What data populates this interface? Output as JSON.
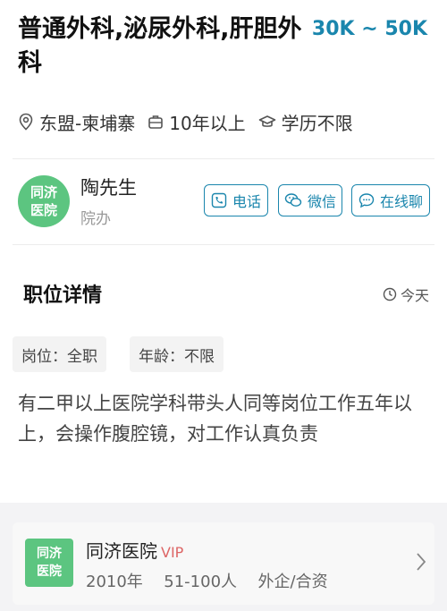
{
  "job": {
    "title": "普通外科,泌尿外科,肝胆外科",
    "salary": "30K ~ 50K",
    "location": "东盟-柬埔寨",
    "experience": "10年以上",
    "education": "学历不限"
  },
  "recruiter": {
    "avatar_text": "同济\n医院",
    "name": "陶先生",
    "department": "院办",
    "buttons": {
      "phone": "电话",
      "wechat": "微信",
      "chat": "在线聊"
    }
  },
  "details": {
    "section_title": "职位详情",
    "posted": "今天",
    "tags": [
      "岗位：全职",
      "年龄：不限"
    ],
    "description": "有二甲以上医院学科带头人同等岗位工作五年以上，会操作腹腔镜，对工作认真负责"
  },
  "company": {
    "logo_text": "同济\n医院",
    "name": "同济医院",
    "vip": "VIP",
    "founded": "2010年",
    "size": "51-100人",
    "type": "外企/合资"
  },
  "colors": {
    "accent": "#1a86ad",
    "logo_green": "#5cc580",
    "vip_red": "#d66666"
  }
}
